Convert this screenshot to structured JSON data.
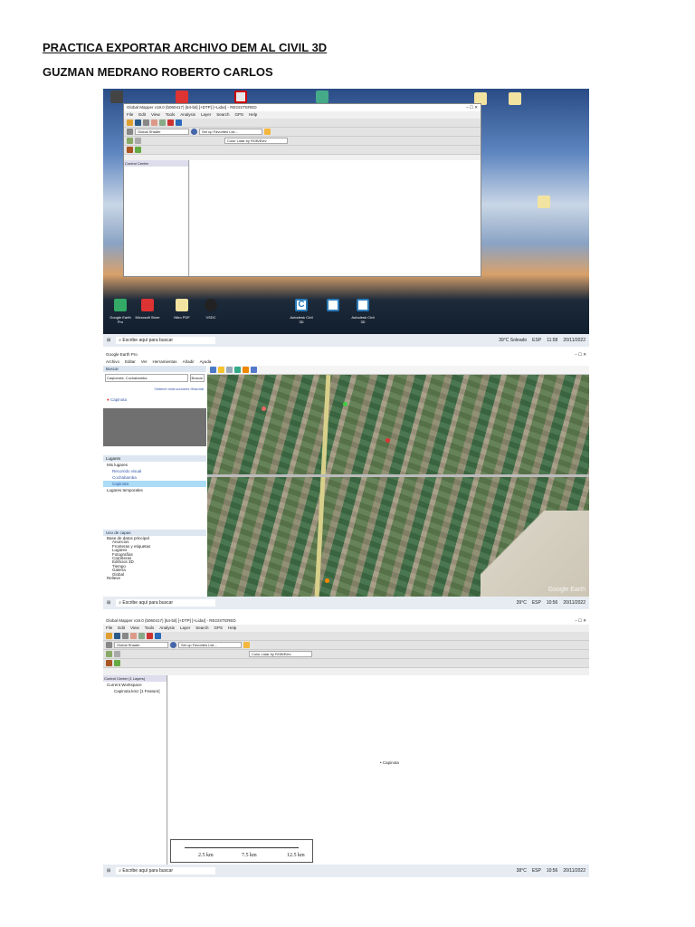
{
  "heading": {
    "title": "PRACTICA EXPORTAR ARCHIVO DEM AL CIVIL 3D",
    "author": "GUZMAN MEDRANO ROBERTO CARLOS"
  },
  "taskbar": {
    "search_placeholder": "Escribe aquí para buscar",
    "weather1": "39°C Soleado",
    "time1": "11:58",
    "date1": "20/11/2022",
    "weather2": "39°C",
    "time2": "10:56",
    "date2": "20/11/2022",
    "weather3": "38°C",
    "time3": "10:56",
    "date3": "20/11/2022",
    "lang": "ESP"
  },
  "gm1": {
    "title": "Global Mapper v19.0 (b060417) [64-bit] [+DTP] [+Lidar] - REGISTERED",
    "menu": [
      "File",
      "Edit",
      "View",
      "Tools",
      "Analysis",
      "Layer",
      "Search",
      "GPS",
      "Help"
    ],
    "shader": "Global Shader",
    "favorites": "Set up Favorites List...",
    "color": "Color Lidar by RGB/Elev",
    "control_center": "Control Center"
  },
  "desktop": {
    "labels": [
      "Google Earth Pro",
      "Microsoft Store",
      "Nitro PDF",
      "VSDC",
      "Autodesk Civil 3D",
      "Autodesk Civil 3D"
    ]
  },
  "ge": {
    "title": "Google Earth Pro",
    "menu": [
      "Archivo",
      "Editar",
      "Ver",
      "Herramientas",
      "Añadir",
      "Ayuda"
    ],
    "search_header": "Buscar",
    "search_value": "Caqtonota, Cochabamba",
    "search_button": "Buscar",
    "directions": "Obtener instrucciones",
    "history": "Historial",
    "result": "Capinota",
    "places_header": "Lugares",
    "places": [
      "Mis lugares",
      "Recorrido visual",
      "Cochabamba",
      "Capinota",
      "Lugares temporales"
    ],
    "layers_header": "Uso de capas",
    "layers": [
      "Base de datos principal",
      "Anuncios",
      "Fronteras y etiquetas",
      "Lugares",
      "Fotografías",
      "Carreteras",
      "Edificios 3D",
      "Tiempo",
      "Galería",
      "Global",
      "Relieve"
    ],
    "watermark": "Google Earth"
  },
  "gm2": {
    "title": "Global Mapper v19.0 (b060417) [64-bit] [+DTP] [+Lidar] - REGISTERED",
    "control_center": "Control Center (1 Layers)",
    "workspace": "Current Workspace",
    "layer": "Capinota.kmz [1 Feature]",
    "map_label": "Capinota",
    "scale": [
      "2.5 km",
      "7.5 km",
      "12.5 km"
    ]
  }
}
